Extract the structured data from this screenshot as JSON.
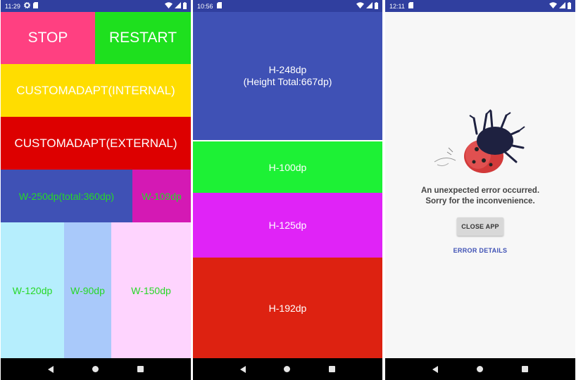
{
  "screens": [
    {
      "status_time": "11:29",
      "buttons": {
        "stop": "STOP",
        "restart": "RESTART",
        "internal": "CUSTOMADAPT(INTERNAL)",
        "external": "CUSTOMADAPT(EXTERNAL)"
      },
      "width_row": {
        "w250": "W-250dp(total:360dp)",
        "w109": "W-109dp"
      },
      "width_columns": {
        "w120": "W-120dp",
        "w90": "W-90dp",
        "w150": "W-150dp"
      }
    },
    {
      "status_time": "10:56",
      "blocks": {
        "h248_line1": "H-248dp",
        "h248_line2": "(Height Total:667dp)",
        "h100": "H-100dp",
        "h125": "H-125dp",
        "h192": "H-192dp"
      }
    },
    {
      "status_time": "12:11",
      "error": {
        "line1": "An unexpected error occurred.",
        "line2": "Sorry for the inconvenience.",
        "close_label": "CLOSE APP",
        "details_label": "ERROR DETAILS"
      }
    }
  ],
  "colors": {
    "status_bar": "#303f9f",
    "accent_pink": "#ff4081",
    "primary_blue": "#3f51b5"
  },
  "icons": [
    "settings-icon",
    "sd-card-icon",
    "wifi-icon",
    "signal-icon",
    "battery-icon",
    "back-icon",
    "home-icon",
    "recents-icon",
    "ladybug-icon"
  ]
}
